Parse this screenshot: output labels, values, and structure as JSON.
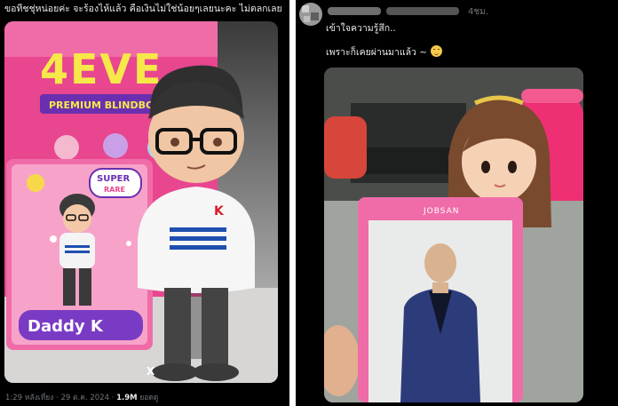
{
  "left_post": {
    "caption": "ขอทีชชุ่หน่อยค่ะ จะร้องไห้แล้ว คือเงินไม่ใช่น้อยๆเลยนะคะ ไม่ตลกเลย",
    "image": {
      "box_brand": "4EVE",
      "box_banner": "PREMIUM BLINDBOX",
      "card_badge_top": "SUPER",
      "card_badge_bottom": "RARE",
      "card_name": "Daddy K",
      "hoodie_letter": "K",
      "foot_letter": "X"
    },
    "meta": {
      "time": "1:29 หลังเที่ยง",
      "date": "29 ต.ค. 2024",
      "views_value": "1.9M",
      "views_label": "ยอดดู"
    }
  },
  "right_post": {
    "username": "",
    "time": "4ชม.",
    "line1": "เข้าใจความรู้สึก..",
    "line2": "เพราะก็เคยผ่านมาแล้ว ~",
    "emoji_icon": "relieved-face-emoji",
    "image": {
      "card_name": "JOBSAN"
    }
  },
  "colors": {
    "background": "#000000",
    "text": "#e7e9ea",
    "muted": "#71767b",
    "box_pink": "#e8468f",
    "card_pink": "#f06ca8"
  }
}
